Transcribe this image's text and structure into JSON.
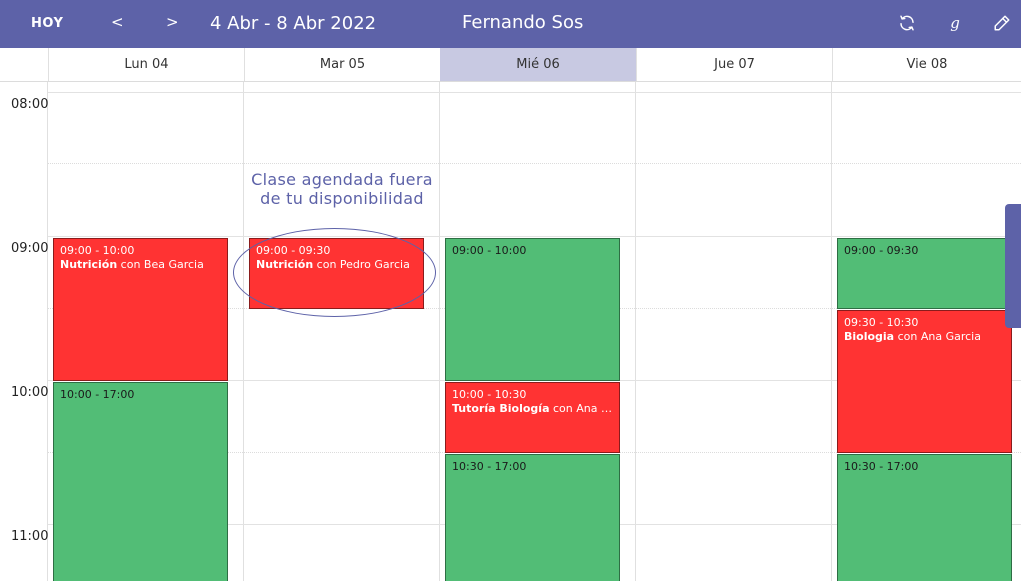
{
  "toolbar": {
    "today_label": "HOY",
    "prev_label": "<",
    "next_label": ">",
    "date_range": "4 Abr - 8 Abr 2022",
    "user_name": "Fernando Sos",
    "google_label": "g"
  },
  "days": [
    {
      "label": "Lun 04",
      "today": false
    },
    {
      "label": "Mar 05",
      "today": false
    },
    {
      "label": "Mié 06",
      "today": true
    },
    {
      "label": "Jue 07",
      "today": false
    },
    {
      "label": "Vie 08",
      "today": false
    }
  ],
  "hours": [
    "08:00",
    "09:00",
    "10:00",
    "11:00"
  ],
  "events": {
    "lun_1": {
      "time": "09:00 - 10:00",
      "subject": "Nutrición",
      "rest": " con Bea Garcia"
    },
    "lun_2": {
      "time": "10:00 - 17:00"
    },
    "mar_1": {
      "time": "09:00 - 09:30",
      "subject": "Nutrición",
      "rest": " con Pedro Garcia"
    },
    "mie_1": {
      "time": "09:00 - 10:00"
    },
    "mie_2": {
      "time": "10:00 - 10:30",
      "subject": "Tutoría Biología",
      "rest": " con Ana Gar..."
    },
    "mie_3": {
      "time": "10:30 - 17:00"
    },
    "vie_1": {
      "time": "09:00 - 09:30"
    },
    "vie_2": {
      "time": "09:30 - 10:30",
      "subject": "Biologia",
      "rest": " con Ana Garcia"
    },
    "vie_3": {
      "time": "10:30 - 17:00"
    }
  },
  "annotation": {
    "line1": "Clase agendada fuera",
    "line2": "de tu disponibilidad"
  },
  "colors": {
    "header": "#5d62a8",
    "today_column": "#c8c9e2",
    "busy_event": "#ff3333",
    "available_event": "#52bd76"
  }
}
